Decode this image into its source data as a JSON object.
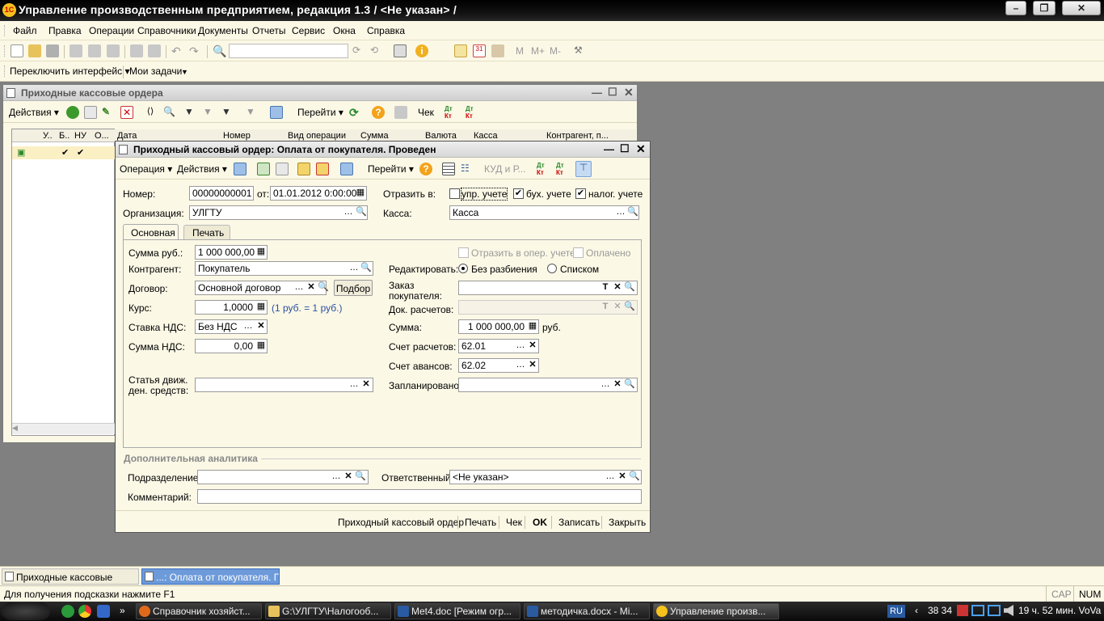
{
  "app_title": "Управление производственным предприятием, редакция 1.3 / <Не указан> /",
  "menu": [
    "Файл",
    "Правка",
    "Операции",
    "Справочники",
    "Документы",
    "Отчеты",
    "Сервис",
    "Окна",
    "Справка"
  ],
  "toolbar2": {
    "switch": "Переключить интерфейс",
    "tasks": "Мои задачи"
  },
  "list_window": {
    "title": "Приходные кассовые ордера",
    "actions": "Действия",
    "goto": "Перейти",
    "check": "Чек",
    "columns": [
      "У..",
      "Б..",
      "НУ",
      "О...",
      "Дата",
      "Номер",
      "Вид операции",
      "Сумма",
      "Валюта",
      "Касса",
      "Контрагент, п..."
    ]
  },
  "doc_window": {
    "title": "Приходный кассовый ордер: Оплата от покупателя. Проведен",
    "toolbar": {
      "operation": "Операция",
      "actions": "Действия",
      "goto": "Перейти",
      "kud": "КУД и Р..."
    },
    "number_label": "Номер:",
    "number": "00000000001",
    "from_label": "от:",
    "date": "01.01.2012  0:00:00",
    "reflect_label": "Отразить в:",
    "upr": "упр. учете",
    "buh": "бух. учете",
    "nalog": "налог. учете",
    "org_label": "Организация:",
    "org": "УЛГТУ",
    "kassa_label": "Касса:",
    "kassa": "Касса",
    "tabs": [
      "Основная",
      "Печать"
    ],
    "summa_rub_label": "Сумма руб.:",
    "summa_rub": "1 000 000,00",
    "oper_label": "Отразить в опер. учете",
    "paid_label": "Оплачено",
    "kontragent_label": "Контрагент:",
    "kontragent": "Покупатель",
    "edit_label": "Редактировать:",
    "no_split": "Без разбиения",
    "by_list": "Списком",
    "dogovor_label": "Договор:",
    "dogovor": "Основной договор",
    "podbor": "Подбор",
    "order_label": "Заказ покупателя:",
    "docs_label": "Док. расчетов:",
    "kurs_label": "Курс:",
    "kurs": "1,0000",
    "kurs_note": "(1 руб. = 1 руб.)",
    "summa_label": "Сумма:",
    "summa": "1 000 000,00",
    "rub": "руб.",
    "nds_rate_label": "Ставка НДС:",
    "nds_rate": "Без НДС",
    "schet_rasch_label": "Счет расчетов:",
    "schet_rasch": "62.01",
    "nds_sum_label": "Сумма НДС:",
    "nds_sum": "0,00",
    "schet_av_label": "Счет авансов:",
    "schet_av": "62.02",
    "statya_label1": "Статья движ.",
    "statya_label2": "ден. средств:",
    "planned_label": "Запланировано:",
    "analytics": "Дополнительная аналитика",
    "podr_label": "Подразделение:",
    "resp_label": "Ответственный:",
    "resp": "<Не указан>",
    "comment_label": "Комментарий:",
    "bottom": [
      "Приходный кассовый ордер",
      "Печать",
      "Чек",
      "OK",
      "Записать",
      "Закрыть"
    ]
  },
  "win_tabs": [
    "Приходные кассовые ордера",
    "...: Оплата от покупателя. П..."
  ],
  "status": {
    "hint": "Для получения подсказки нажмите F1",
    "cap": "CAP",
    "num": "NUM"
  },
  "os_taskbar": {
    "tasks": [
      "Справочник хозяйст...",
      "G:\\УЛГТУ\\Налогооб...",
      "Met4.doc [Режим огр...",
      "методичка.docx - Mi...",
      "Управление произв..."
    ],
    "lang": "RU",
    "clock": "19 ч. 52 мин. VoVa",
    "tray_num": "38 34"
  }
}
